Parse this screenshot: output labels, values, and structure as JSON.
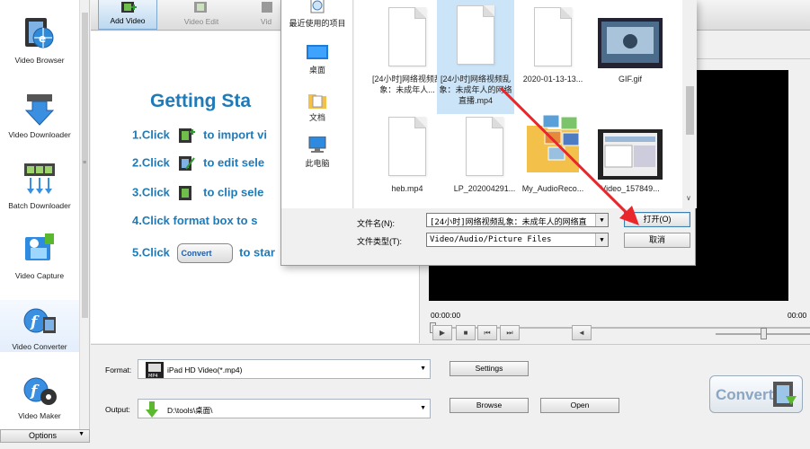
{
  "toolbar": {
    "add_video": "Add Video",
    "video_edit": "Video Edit",
    "third_button": "Vid"
  },
  "sidebar": {
    "items": [
      {
        "label": "Video Browser"
      },
      {
        "label": "Video Downloader"
      },
      {
        "label": "Batch Downloader"
      },
      {
        "label": "Video Capture"
      },
      {
        "label": "Video Converter"
      },
      {
        "label": "Video Maker"
      }
    ],
    "options": "Options"
  },
  "getting_started": {
    "title": "Getting Sta",
    "steps": [
      {
        "num": "1.Click",
        "text": "to import vi"
      },
      {
        "num": "2.Click",
        "text": "to edit sele"
      },
      {
        "num": "3.Click",
        "text": "to clip sele"
      },
      {
        "num": "4.Click format box to s",
        "text": ""
      },
      {
        "num": "5.Click",
        "text": "to star"
      }
    ],
    "inline_convert": "Convert"
  },
  "preview": {
    "time_start": "00:00:00",
    "time_end": "00:00"
  },
  "bottom": {
    "format_label": "Format:",
    "format_value": "iPad HD Video(*.mp4)",
    "output_label": "Output:",
    "output_value": "D:\\tools\\桌面\\",
    "settings": "Settings",
    "browse": "Browse",
    "open": "Open",
    "convert": "Convert"
  },
  "dialog": {
    "places": [
      {
        "label": "最近使用的项目"
      },
      {
        "label": "桌面"
      },
      {
        "label": "文档"
      },
      {
        "label": "此电脑"
      }
    ],
    "files": [
      {
        "name": "[24小时]网络视频乱象：未成年人..."
      },
      {
        "name": "[24小时]网络视频乱象：未成年人的网络直播.mp4"
      },
      {
        "name": "2020-01-13-13..."
      },
      {
        "name": "GIF.gif"
      },
      {
        "name": "heb.mp4"
      },
      {
        "name": "LP_202004291..."
      },
      {
        "name": "My_AudioReco..."
      },
      {
        "name": "Video_157849..."
      }
    ],
    "filename_label": "文件名(N):",
    "filename_value": "[24小时]网络视频乱象：未成年人的网络直",
    "filetype_label": "文件类型(T):",
    "filetype_value": "Video/Audio/Picture Files",
    "open_button": "打开(O)",
    "cancel_button": "取消"
  },
  "colors": {
    "accent_blue": "#1f7bb8",
    "selection": "#cce4f7",
    "annotation_red": "#e8262b"
  }
}
